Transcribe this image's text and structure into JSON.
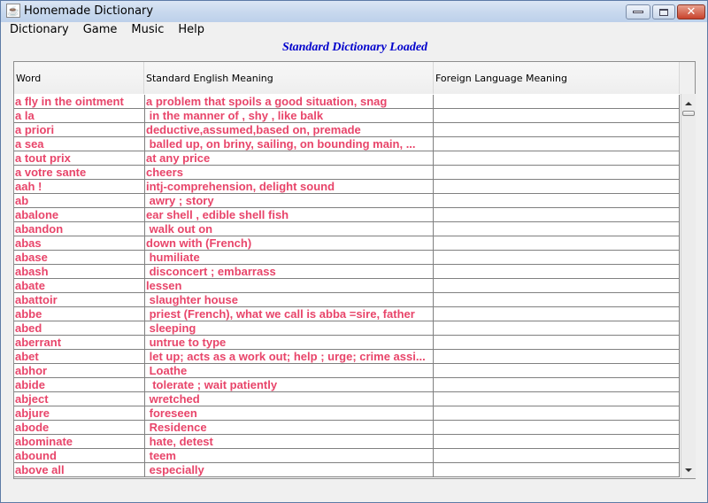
{
  "window": {
    "title": "Homemade Dictionary",
    "icon": "java-cup-icon"
  },
  "menu": [
    {
      "label": "Dictionary"
    },
    {
      "label": "Game"
    },
    {
      "label": "Music"
    },
    {
      "label": "Help"
    }
  ],
  "status": {
    "text": "Standard Dictionary Loaded",
    "color": "#0000cc"
  },
  "table": {
    "text_color": "#e8456a",
    "columns": [
      "Word",
      "Standard English Meaning",
      "Foreign Language Meaning"
    ],
    "rows": [
      [
        "a fly in the ointment",
        "a problem that spoils a good situation, snag",
        ""
      ],
      [
        "a la",
        " in the manner of , shy , like balk",
        ""
      ],
      [
        "a priori",
        "deductive,assumed,based on, premade",
        ""
      ],
      [
        "a sea",
        " balled up, on briny, sailing, on bounding main, ...",
        ""
      ],
      [
        "a tout prix",
        "at any price",
        ""
      ],
      [
        "a votre sante",
        "cheers",
        ""
      ],
      [
        "aah !",
        "intj-comprehension, delight sound",
        ""
      ],
      [
        "ab",
        " awry ; story",
        ""
      ],
      [
        "abalone",
        "ear shell , edible shell fish",
        ""
      ],
      [
        "abandon",
        " walk out on",
        ""
      ],
      [
        "abas",
        "down with (French)",
        ""
      ],
      [
        "abase",
        " humiliate",
        ""
      ],
      [
        "abash",
        " disconcert ; embarrass",
        ""
      ],
      [
        "abate",
        "lessen",
        ""
      ],
      [
        "abattoir",
        " slaughter house",
        ""
      ],
      [
        "abbe",
        " priest (French), what we call is abba =sire, father",
        ""
      ],
      [
        "abed",
        " sleeping",
        ""
      ],
      [
        "aberrant",
        " untrue to type",
        ""
      ],
      [
        "abet",
        " let up; acts as a work out; help ; urge; crime assi...",
        ""
      ],
      [
        "abhor",
        " Loathe",
        ""
      ],
      [
        "abide",
        "  tolerate ; wait patiently",
        ""
      ],
      [
        "abject",
        " wretched",
        ""
      ],
      [
        "abjure",
        " foreseen",
        ""
      ],
      [
        "abode",
        " Residence",
        ""
      ],
      [
        "abominate",
        " hate, detest",
        ""
      ],
      [
        "abound",
        " teem",
        ""
      ],
      [
        "above all",
        " especially",
        ""
      ]
    ]
  }
}
